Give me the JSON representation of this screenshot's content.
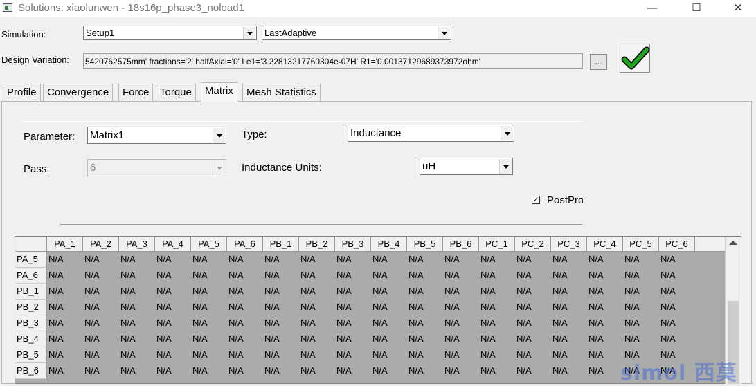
{
  "window": {
    "title": "Solutions: xiaolunwen - 18s16p_phase3_noload1",
    "minimize_glyph": "—",
    "maximize_glyph": "☐",
    "close_glyph": "✕"
  },
  "simulation": {
    "label": "Simulation:",
    "setup_value": "Setup1",
    "solution_value": "LastAdaptive"
  },
  "design_variation": {
    "label": "Design Variation:",
    "value": "5420762575mm' fractions='2' halfAxial='0' Le1='3.22813217760304e-07H' R1='0.00137129689373972ohm'",
    "browse_label": "...",
    "apply_icon": "green-checkmark-icon"
  },
  "tabs": [
    {
      "label": "Profile"
    },
    {
      "label": "Convergence"
    },
    {
      "label": "Force"
    },
    {
      "label": "Torque"
    },
    {
      "label": "Matrix"
    },
    {
      "label": "Mesh Statistics"
    }
  ],
  "active_tab": "Matrix",
  "matrix": {
    "parameter_label": "Parameter:",
    "parameter_value": "Matrix1",
    "type_label": "Type:",
    "type_value": "Inductance",
    "pass_label": "Pass:",
    "pass_value": "6",
    "units_label": "Inductance Units:",
    "units_value": "uH",
    "postpro_label": "PostPro",
    "postpro_checked": "✓"
  },
  "table": {
    "columns": [
      "PA_1",
      "PA_2",
      "PA_3",
      "PA_4",
      "PA_5",
      "PA_6",
      "PB_1",
      "PB_2",
      "PB_3",
      "PB_4",
      "PB_5",
      "PB_6",
      "PC_1",
      "PC_2",
      "PC_3",
      "PC_4",
      "PC_5",
      "PC_6"
    ],
    "rows": [
      {
        "label": "PA_5",
        "cells": [
          "N/A",
          "N/A",
          "N/A",
          "N/A",
          "N/A",
          "N/A",
          "N/A",
          "N/A",
          "N/A",
          "N/A",
          "N/A",
          "N/A",
          "N/A",
          "N/A",
          "N/A",
          "N/A",
          "N/A",
          "N/A"
        ]
      },
      {
        "label": "PA_6",
        "cells": [
          "N/A",
          "N/A",
          "N/A",
          "N/A",
          "N/A",
          "N/A",
          "N/A",
          "N/A",
          "N/A",
          "N/A",
          "N/A",
          "N/A",
          "N/A",
          "N/A",
          "N/A",
          "N/A",
          "N/A",
          "N/A"
        ]
      },
      {
        "label": "PB_1",
        "cells": [
          "N/A",
          "N/A",
          "N/A",
          "N/A",
          "N/A",
          "N/A",
          "N/A",
          "N/A",
          "N/A",
          "N/A",
          "N/A",
          "N/A",
          "N/A",
          "N/A",
          "N/A",
          "N/A",
          "N/A",
          "N/A"
        ]
      },
      {
        "label": "PB_2",
        "cells": [
          "N/A",
          "N/A",
          "N/A",
          "N/A",
          "N/A",
          "N/A",
          "N/A",
          "N/A",
          "N/A",
          "N/A",
          "N/A",
          "N/A",
          "N/A",
          "N/A",
          "N/A",
          "N/A",
          "N/A",
          "N/A"
        ]
      },
      {
        "label": "PB_3",
        "cells": [
          "N/A",
          "N/A",
          "N/A",
          "N/A",
          "N/A",
          "N/A",
          "N/A",
          "N/A",
          "N/A",
          "N/A",
          "N/A",
          "N/A",
          "N/A",
          "N/A",
          "N/A",
          "N/A",
          "N/A",
          "N/A"
        ]
      },
      {
        "label": "PB_4",
        "cells": [
          "N/A",
          "N/A",
          "N/A",
          "N/A",
          "N/A",
          "N/A",
          "N/A",
          "N/A",
          "N/A",
          "N/A",
          "N/A",
          "N/A",
          "N/A",
          "N/A",
          "N/A",
          "N/A",
          "N/A",
          "N/A"
        ]
      },
      {
        "label": "PB_5",
        "cells": [
          "N/A",
          "N/A",
          "N/A",
          "N/A",
          "N/A",
          "N/A",
          "N/A",
          "N/A",
          "N/A",
          "N/A",
          "N/A",
          "N/A",
          "N/A",
          "N/A",
          "N/A",
          "N/A",
          "N/A",
          "N/A"
        ]
      },
      {
        "label": "PB_6",
        "cells": [
          "N/A",
          "N/A",
          "N/A",
          "N/A",
          "N/A",
          "N/A",
          "N/A",
          "N/A",
          "N/A",
          "N/A",
          "N/A",
          "N/A",
          "N/A",
          "N/A",
          "N/A",
          "N/A",
          "N/A",
          "N/A"
        ]
      }
    ]
  },
  "watermark": "simol 西莫",
  "colors": {
    "grid_background": "#ababab",
    "check_green": "#1fa81f",
    "watermark_blue": "#4a6fd0"
  }
}
